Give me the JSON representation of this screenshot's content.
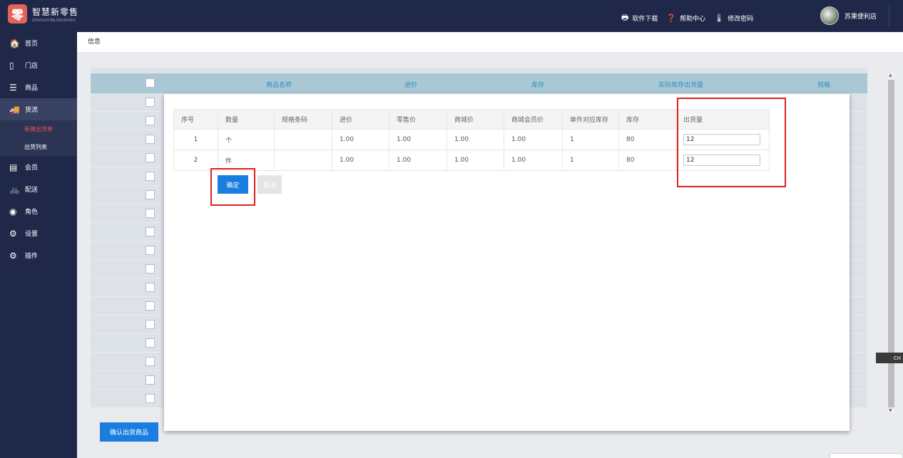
{
  "header": {
    "logo_char": "零",
    "logo_cn": "智慧新零售",
    "logo_en": "ZHIHUIXINLINGSHOU",
    "links": [
      {
        "icon": "printer-icon",
        "glyph": "🖶",
        "label": "软件下载"
      },
      {
        "icon": "help-icon",
        "glyph": "❓",
        "label": "帮助中心"
      },
      {
        "icon": "thermometer-icon",
        "glyph": "🌡",
        "label": "修改密码"
      }
    ],
    "user_name": "苏果便利店"
  },
  "sidebar": {
    "items": [
      {
        "label": "首页",
        "glyph": "🏠",
        "icon": "home-icon"
      },
      {
        "label": "门店",
        "glyph": "▯",
        "icon": "store-icon"
      },
      {
        "label": "商品",
        "glyph": "☰",
        "icon": "list-icon"
      },
      {
        "label": "货流",
        "glyph": "🚚",
        "icon": "truck-icon"
      },
      {
        "label": "会员",
        "glyph": "▤",
        "icon": "member-card-icon"
      },
      {
        "label": "配送",
        "glyph": "🚲",
        "icon": "bike-icon"
      },
      {
        "label": "角色",
        "glyph": "◉",
        "icon": "user-circle-icon"
      },
      {
        "label": "设置",
        "glyph": "⚙",
        "icon": "gear-icon"
      },
      {
        "label": "插件",
        "glyph": "⚙",
        "icon": "plugin-icon"
      }
    ],
    "sub_items": [
      "新建出货单",
      "出货列表"
    ]
  },
  "breadcrumb": "信息",
  "bg_table": {
    "headers": [
      "商品名称",
      "进价",
      "库存",
      "实际库存出货量",
      "规格"
    ]
  },
  "modal": {
    "columns": [
      "序号",
      "数量",
      "规格条码",
      "进价",
      "零售价",
      "商城价",
      "商城会员价",
      "单件对应库存",
      "库存",
      "出货量"
    ],
    "rows": [
      {
        "no": "1",
        "unit": "个",
        "barcode": "",
        "cost": "1.00",
        "retail": "1.00",
        "mall": "1.00",
        "member": "1.00",
        "per_stock": "1",
        "stock": "80",
        "qty": "12"
      },
      {
        "no": "2",
        "unit": "件",
        "barcode": "",
        "cost": "1.00",
        "retail": "1.00",
        "mall": "1.00",
        "member": "1.00",
        "per_stock": "1",
        "stock": "80",
        "qty": "12"
      }
    ],
    "ok_label": "确定",
    "cancel_label": "取消"
  },
  "bottom_button": "确认出货商品",
  "side_widget": "CH",
  "colors": {
    "primary": "#1a7de0",
    "sidebar": "#20284a",
    "highlight": "#e02020"
  }
}
